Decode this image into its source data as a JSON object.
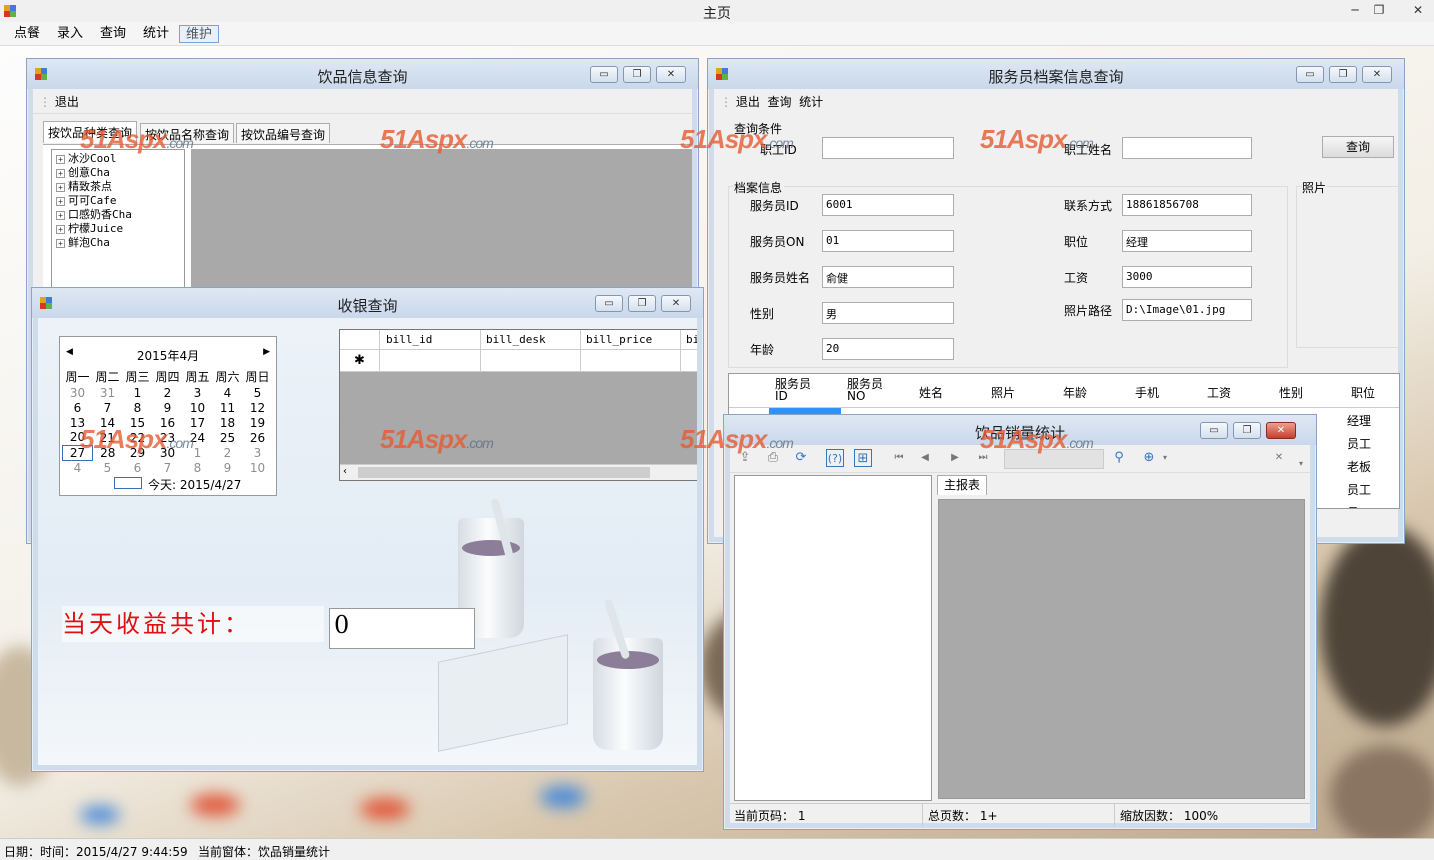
{
  "app": {
    "title": "主页",
    "minimize": "─",
    "restore": "❐",
    "close": "✕"
  },
  "menu": [
    "点餐",
    "录入",
    "查询",
    "统计",
    "维护"
  ],
  "status": {
    "datetime": "日期：时间：2015/4/27 9:44:59",
    "current": "当前窗体：饮品销量统计"
  },
  "watermark": {
    "main": "51Aspx",
    "sub": ".com"
  },
  "drink_win": {
    "title": "饮品信息查询",
    "toolbar_exit": "退出",
    "tabs": [
      "按饮品种类查询",
      "按饮品名称查询",
      "按饮品编号查询"
    ],
    "tree": [
      "冰沙Cool",
      "创意Cha",
      "精致茶点",
      "可可Cafe",
      "口感奶香Cha",
      "柠檬Juice",
      "鲜泡Cha"
    ]
  },
  "staff_win": {
    "title": "服务员档案信息查询",
    "toolbar": [
      "退出",
      "查询",
      "统计"
    ],
    "query_group": "查询条件",
    "q_id_label": "职工ID",
    "q_name_label": "职工姓名",
    "query_btn": "查询",
    "archive_group": "档案信息",
    "photo_group": "照片",
    "labels": {
      "id": "服务员ID",
      "no": "服务员ON",
      "name": "服务员姓名",
      "sex": "性别",
      "age": "年龄",
      "phone": "联系方式",
      "post": "职位",
      "salary": "工资",
      "photo_path": "照片路径"
    },
    "values": {
      "id": "6001",
      "no": "01",
      "name": "俞健",
      "sex": "男",
      "age": "20",
      "phone": "18861856708",
      "post": "经理",
      "salary": "3000",
      "photo_path": "D:\\Image\\01.jpg"
    },
    "grid_columns": [
      "服务员\nID",
      "服务员\nNO",
      "姓名",
      "照片",
      "年龄",
      "手机",
      "工资",
      "性别",
      "职位"
    ],
    "grid_posts": [
      "经理",
      "员工",
      "老板",
      "员工",
      "员工"
    ]
  },
  "cash_win": {
    "title": "收银查询",
    "calendar": {
      "month": "2015年4月",
      "weekdays": [
        "周一",
        "周二",
        "周三",
        "周四",
        "周五",
        "周六",
        "周日"
      ],
      "weeks": [
        [
          "30",
          "31",
          "1",
          "2",
          "3",
          "4",
          "5"
        ],
        [
          "6",
          "7",
          "8",
          "9",
          "10",
          "11",
          "12"
        ],
        [
          "13",
          "14",
          "15",
          "16",
          "17",
          "18",
          "19"
        ],
        [
          "20",
          "21",
          "22",
          "23",
          "24",
          "25",
          "26"
        ],
        [
          "27",
          "28",
          "29",
          "30",
          "1",
          "2",
          "3"
        ],
        [
          "4",
          "5",
          "6",
          "7",
          "8",
          "9",
          "10"
        ]
      ],
      "today": "今天: 2015/4/27"
    },
    "grid_columns": [
      "bill_id",
      "bill_desk",
      "bill_price",
      "bi"
    ],
    "new_row_marker": "✱",
    "income_label": "当天收益共计：",
    "income_value": "0"
  },
  "sales_win": {
    "title": "饮品销量统计",
    "tab": "主报表",
    "page_current": "当前页码： 1",
    "page_total": "总页数： 1+",
    "zoom": "缩放因数： 100%"
  }
}
